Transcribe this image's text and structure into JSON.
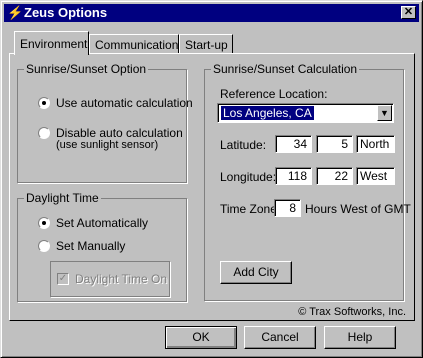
{
  "window": {
    "title": "Zeus Options",
    "close": "✕"
  },
  "tabs": [
    "Environment",
    "Communications",
    "Start-up"
  ],
  "sun_option": {
    "legend": "Sunrise/Sunset Option",
    "auto": "Use automatic calculation",
    "disable_line1": "Disable auto calculation",
    "disable_line2": "(use sunlight sensor)",
    "selected": "auto"
  },
  "daylight": {
    "legend": "Daylight Time",
    "auto": "Set Automatically",
    "manual": "Set Manually",
    "on_label": "Daylight Time On",
    "selected": "auto"
  },
  "calc": {
    "legend": "Sunrise/Sunset Calculation",
    "ref_label": "Reference Location:",
    "ref_value": "Los Angeles, CA",
    "lat_label": "Latitude:",
    "lat_deg": "34",
    "lat_min": "5",
    "lat_dir": "North",
    "lon_label": "Longitude:",
    "lon_deg": "118",
    "lon_min": "22",
    "lon_dir": "West",
    "tz_label": "Time Zone:",
    "tz_value": "8",
    "tz_suffix": "Hours West of GMT",
    "add_city": "Add City"
  },
  "copyright": "© Trax Softworks, Inc.",
  "buttons": {
    "ok": "OK",
    "cancel": "Cancel",
    "help": "Help"
  }
}
